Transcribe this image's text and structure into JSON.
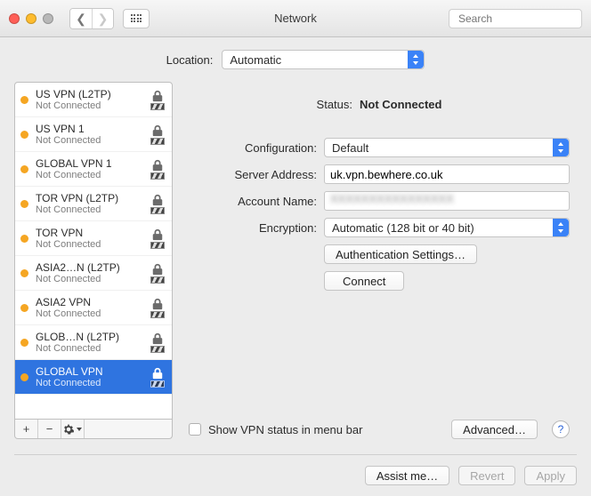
{
  "window": {
    "title": "Network"
  },
  "search": {
    "placeholder": "Search"
  },
  "location": {
    "label": "Location:",
    "value": "Automatic"
  },
  "sidebar": {
    "items": [
      {
        "name": "US VPN (L2TP)",
        "status": "Not Connected"
      },
      {
        "name": "US VPN 1",
        "status": "Not Connected"
      },
      {
        "name": "GLOBAL VPN 1",
        "status": "Not Connected"
      },
      {
        "name": "TOR VPN (L2TP)",
        "status": "Not Connected"
      },
      {
        "name": "TOR VPN",
        "status": "Not Connected"
      },
      {
        "name": "ASIA2…N (L2TP)",
        "status": "Not Connected"
      },
      {
        "name": "ASIA2 VPN",
        "status": "Not Connected"
      },
      {
        "name": "GLOB…N (L2TP)",
        "status": "Not Connected"
      },
      {
        "name": "GLOBAL VPN",
        "status": "Not Connected"
      }
    ],
    "selected_index": 8
  },
  "detail": {
    "status_label": "Status:",
    "status_value": "Not Connected",
    "config_label": "Configuration:",
    "config_value": "Default",
    "server_label": "Server Address:",
    "server_value": "uk.vpn.bewhere.co.uk",
    "account_label": "Account Name:",
    "account_value": "XXXXXXXXXXXXXXXX",
    "encryption_label": "Encryption:",
    "encryption_value": "Automatic (128 bit or 40 bit)",
    "auth_button": "Authentication Settings…",
    "connect_button": "Connect",
    "show_menubar": "Show VPN status in menu bar",
    "advanced": "Advanced…"
  },
  "footer": {
    "assist": "Assist me…",
    "revert": "Revert",
    "apply": "Apply"
  }
}
